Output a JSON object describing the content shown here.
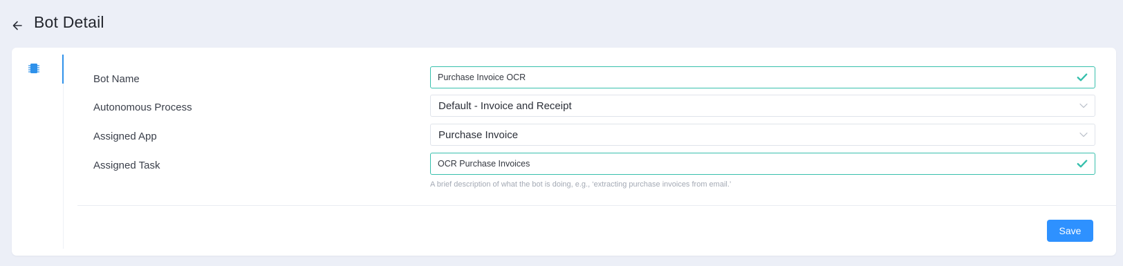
{
  "header": {
    "title": "Bot Detail",
    "back_icon": "arrow-left-icon"
  },
  "sidebar": {
    "tabs": [
      {
        "icon": "chip-icon",
        "active": true
      }
    ]
  },
  "form": {
    "bot_name": {
      "label": "Bot Name",
      "value": "Purchase Invoice OCR",
      "status": "valid"
    },
    "autonomous_process": {
      "label": "Autonomous Process",
      "selected": "Default - Invoice and Receipt"
    },
    "assigned_app": {
      "label": "Assigned App",
      "selected": "Purchase Invoice"
    },
    "assigned_task": {
      "label": "Assigned Task",
      "value": "OCR Purchase Invoices",
      "status": "valid",
      "help": "A brief description of what the bot is doing, e.g., ‘extracting purchase invoices from email.’"
    }
  },
  "footer": {
    "save_label": "Save"
  },
  "colors": {
    "accent": "#2e91ff",
    "valid": "#36bfac",
    "background": "#eceff7"
  }
}
